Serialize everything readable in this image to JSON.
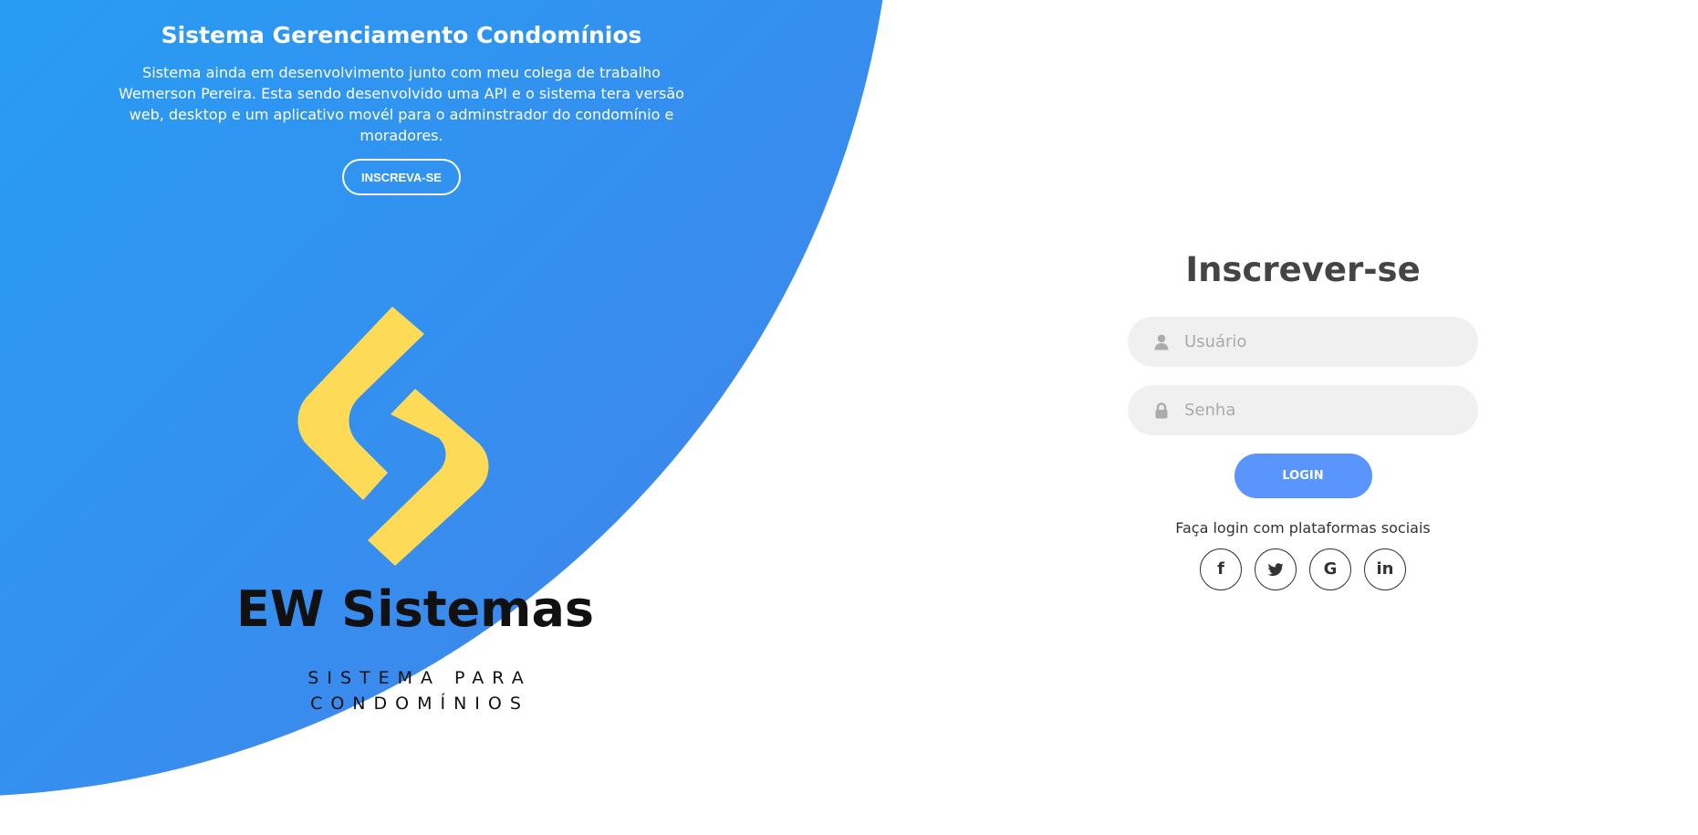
{
  "intro": {
    "title": "Sistema Gerenciamento Condomínios",
    "description": "Sistema ainda em desenvolvimento junto com meu colega de trabalho Wemerson Pereira. Esta sendo desenvolvido uma API e o sistema tera versão web, desktop e um aplicativo movél para o adminstrador do condomínio e moradores.",
    "signup_button": "INSCREVA-SE"
  },
  "logo": {
    "name": "EW Sistemas",
    "subtitle_line1": "SISTEMA PARA",
    "subtitle_line2": "CONDOMÍNIOS",
    "mark_color": "#fddb57"
  },
  "form": {
    "title": "Inscrever-se",
    "username": {
      "placeholder": "Usuário",
      "value": "",
      "icon": "user-icon"
    },
    "password": {
      "placeholder": "Senha",
      "value": "",
      "icon": "lock-icon"
    },
    "login_button": "LOGIN",
    "social_text": "Faça login com plataformas sociais",
    "social": [
      {
        "name": "facebook",
        "icon": "facebook-icon",
        "glyph": "f"
      },
      {
        "name": "twitter",
        "icon": "twitter-icon",
        "glyph": ""
      },
      {
        "name": "google",
        "icon": "google-icon",
        "glyph": "G"
      },
      {
        "name": "linkedin",
        "icon": "linkedin-icon",
        "glyph": "in"
      }
    ]
  },
  "colors": {
    "gradient_start": "#04befe",
    "gradient_end": "#4481eb",
    "button": "#5995fd",
    "input_bg": "#f0f0f0",
    "title_text": "#444444",
    "logo_yellow": "#fddb57"
  }
}
